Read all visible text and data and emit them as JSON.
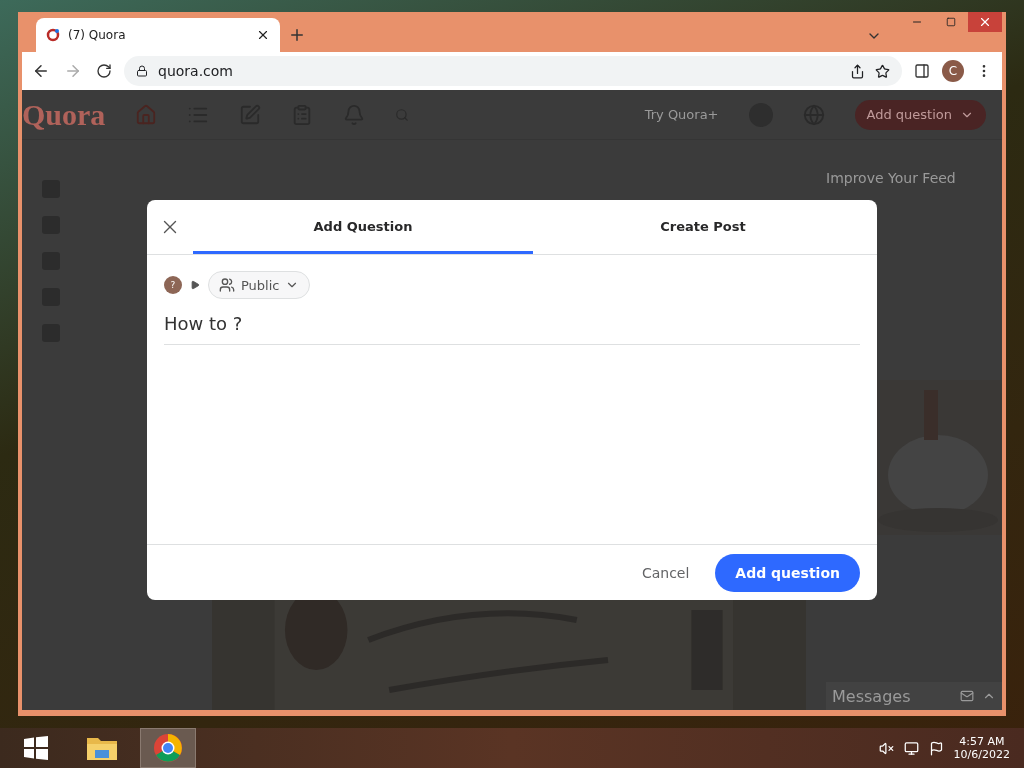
{
  "browser": {
    "tab": {
      "title": "(7) Quora"
    },
    "url": "quora.com",
    "profile_initial": "C"
  },
  "page": {
    "logo": "Quora",
    "header_link": "Try Quora+",
    "header_button": "Add question",
    "feed_title": "Improve Your Feed",
    "messages_label": "Messages"
  },
  "modal": {
    "tabs": [
      {
        "label": "Add Question",
        "selected": true
      },
      {
        "label": "Create Post",
        "selected": false
      }
    ],
    "avatar": "?",
    "audience": "Public",
    "question": {
      "value": "How to ?"
    },
    "cancel": "Cancel",
    "submit": "Add question"
  },
  "taskbar": {
    "time": "4:57 AM",
    "date": "10/6/2022"
  }
}
